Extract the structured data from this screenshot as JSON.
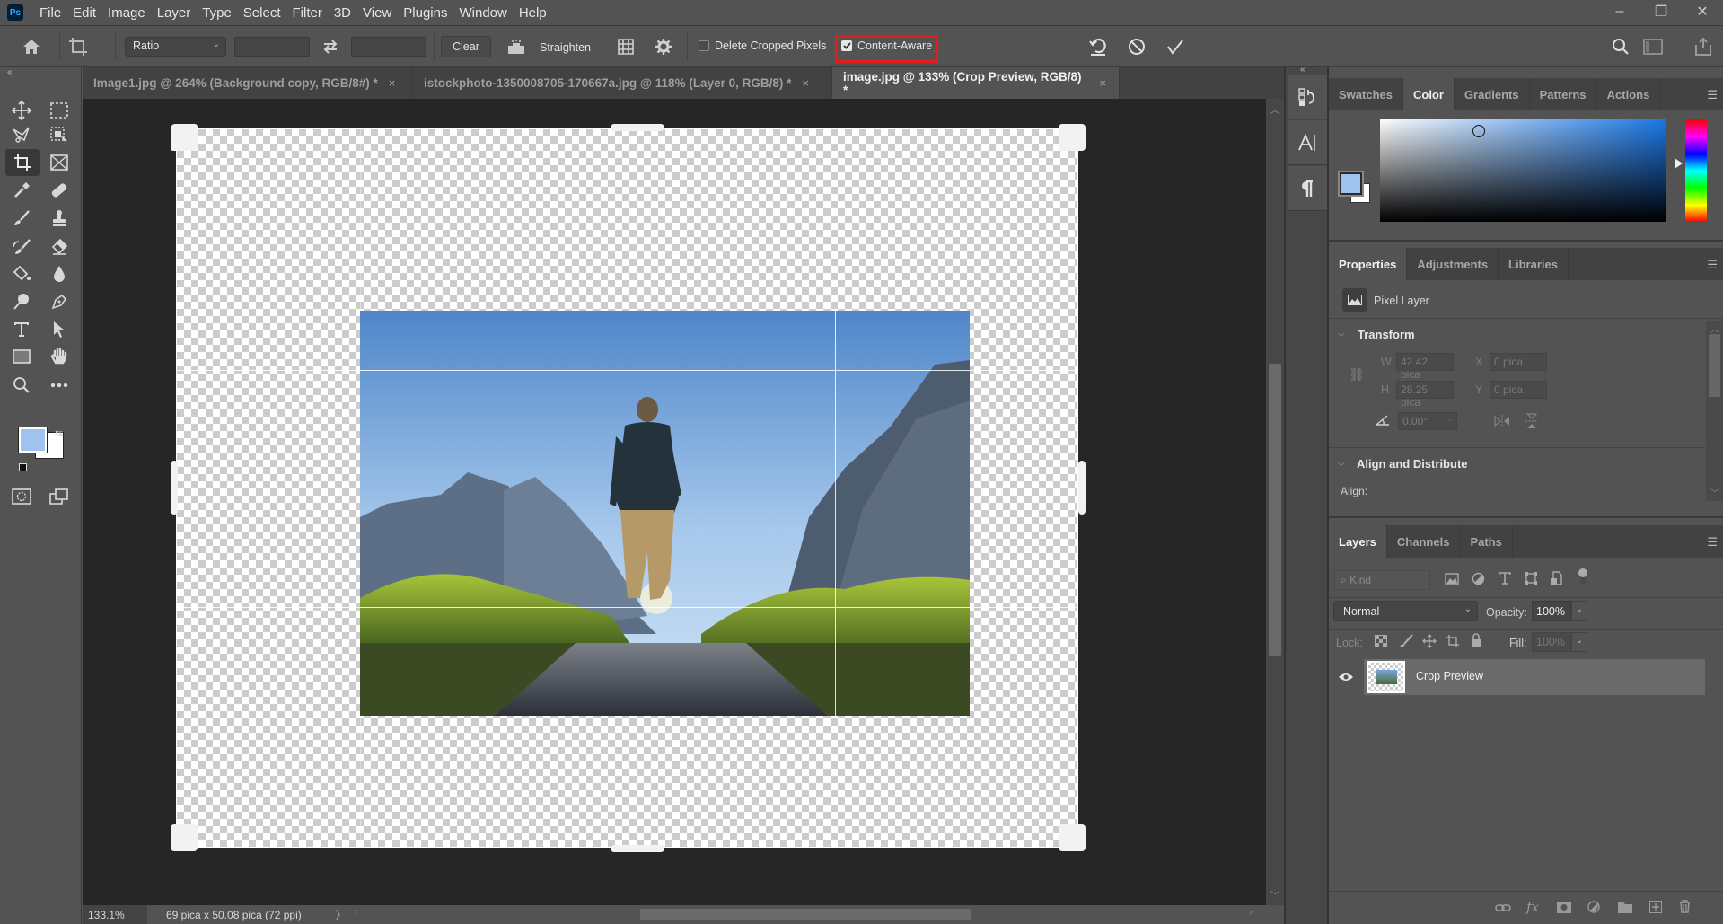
{
  "app": {
    "logo": "Ps",
    "menu": [
      "File",
      "Edit",
      "Image",
      "Layer",
      "Type",
      "Select",
      "Filter",
      "3D",
      "View",
      "Plugins",
      "Window",
      "Help"
    ],
    "window_controls": {
      "minimize": "–",
      "restore": "❐",
      "close": "✕"
    }
  },
  "options_bar": {
    "ratio_select": "Ratio",
    "width_value": "",
    "height_value": "",
    "clear_label": "Clear",
    "straighten_label": "Straighten",
    "delete_cropped_label": "Delete Cropped Pixels",
    "delete_cropped_checked": false,
    "content_aware_label": "Content-Aware",
    "content_aware_checked": true,
    "highlight_color": "#e11d1d"
  },
  "tabs": [
    {
      "label": "Image1.jpg @ 264% (Background copy, RGB/8#) *",
      "active": false
    },
    {
      "label": "istockphoto-1350008705-170667a.jpg @ 118% (Layer 0, RGB/8) *",
      "active": false
    },
    {
      "label": "image.jpg @ 133% (Crop Preview, RGB/8) *",
      "active": true
    }
  ],
  "tab_close": "×",
  "toolbar": {
    "tools": [
      "move",
      "marquee",
      "lasso",
      "object-selection",
      "crop",
      "frame",
      "eyedropper",
      "healing-brush",
      "brush",
      "clone-stamp",
      "history-brush",
      "eraser",
      "paint-bucket",
      "blur",
      "dodge",
      "pen",
      "type",
      "path-selection",
      "rectangle",
      "hand",
      "zoom",
      "more"
    ],
    "active_tool": "crop",
    "foreground_color": "#9fc3ee",
    "background_color": "#ffffff"
  },
  "status_bar": {
    "zoom": "133.1%",
    "doc_info": "69 pica x 50.08 pica (72 ppi)",
    "arrow": "〉"
  },
  "color_panel": {
    "tabs": [
      "Swatches",
      "Color",
      "Gradients",
      "Patterns",
      "Actions"
    ],
    "active_tab": "Color",
    "foreground": "#9fc3ee",
    "background": "#ffffff",
    "hue_color": "#1a78e6"
  },
  "properties_panel": {
    "tabs": [
      "Properties",
      "Adjustments",
      "Libraries"
    ],
    "active_tab": "Properties",
    "layer_type": "Pixel Layer",
    "transform_title": "Transform",
    "w_label": "W",
    "w_value": "42.42 pica",
    "h_label": "H",
    "h_value": "28.25 pica",
    "x_label": "X",
    "x_value": "0 pica",
    "y_label": "Y",
    "y_value": "0 pica",
    "angle_value": "0.00°",
    "align_title": "Align and Distribute",
    "align_label": "Align:"
  },
  "layers_panel": {
    "tabs": [
      "Layers",
      "Channels",
      "Paths"
    ],
    "active_tab": "Layers",
    "filter_placeholder": "Kind",
    "blend_mode": "Normal",
    "opacity_label": "Opacity:",
    "opacity_value": "100%",
    "lock_label": "Lock:",
    "fill_label": "Fill:",
    "fill_value": "100%",
    "layers": [
      {
        "name": "Crop Preview",
        "visible": true,
        "selected": true
      }
    ]
  }
}
